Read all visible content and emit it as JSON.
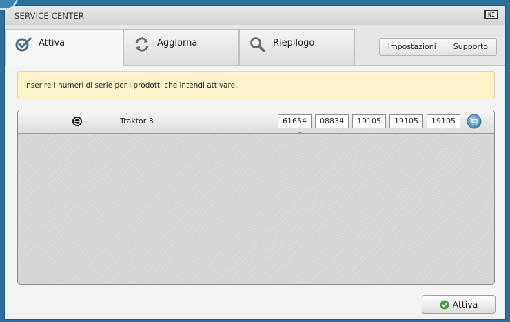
{
  "window": {
    "title": "SERVICE CENTER",
    "logo_text": "NI"
  },
  "tabs": [
    {
      "label": "Attiva",
      "icon": "check-icon",
      "active": true
    },
    {
      "label": "Aggiorna",
      "icon": "refresh-icon",
      "active": false
    },
    {
      "label": "Riepilogo",
      "icon": "magnifier-icon",
      "active": false
    }
  ],
  "top_buttons": {
    "settings": "Impostazioni",
    "support": "Supporto"
  },
  "notice": {
    "text": "Inserire i numeri di serie per i prodotti che intendi attivare."
  },
  "products": [
    {
      "name": "Traktor 3",
      "icon": "traktor-logo-icon",
      "serial": [
        "61654",
        "08834",
        "19105",
        "19105",
        "19105"
      ]
    }
  ],
  "footer": {
    "activate_label": "Attiva"
  },
  "colors": {
    "notice_bg": "#fdf3c8",
    "accent_green": "#3aa445",
    "cart_blue": "#4d8fc1"
  }
}
